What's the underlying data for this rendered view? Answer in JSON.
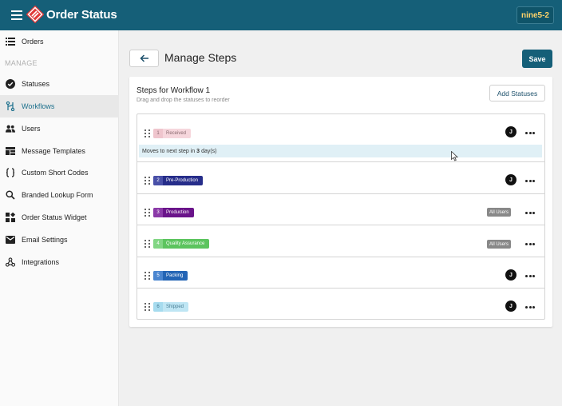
{
  "app": {
    "title": "Order Status",
    "account": "nine5-2"
  },
  "colors": {
    "brand": "#155f78",
    "active_link": "#1b6f8c"
  },
  "sidebar": {
    "top_item": {
      "label": "Orders",
      "icon": "list-icon"
    },
    "section": "MANAGE",
    "items": [
      {
        "label": "Statuses",
        "icon": "check-circle-icon",
        "active": false
      },
      {
        "label": "Workflows",
        "icon": "workflow-icon",
        "active": true
      },
      {
        "label": "Users",
        "icon": "users-icon",
        "active": false
      },
      {
        "label": "Message Templates",
        "icon": "template-icon",
        "active": false
      },
      {
        "label": "Custom Short Codes",
        "icon": "braces-icon",
        "active": false
      },
      {
        "label": "Branded Lookup Form",
        "icon": "search-icon",
        "active": false
      },
      {
        "label": "Order Status Widget",
        "icon": "widget-icon",
        "active": false
      },
      {
        "label": "Email Settings",
        "icon": "mail-icon",
        "active": false
      },
      {
        "label": "Integrations",
        "icon": "integrations-icon",
        "active": false
      }
    ]
  },
  "main": {
    "title": "Manage Steps",
    "save_label": "Save",
    "card": {
      "title": "Steps for Workflow 1",
      "subtitle": "Drag and drop the statuses to reorder",
      "add_label": "Add Statuses"
    },
    "steps": [
      {
        "num": "1",
        "name": "Received",
        "assignee": "J",
        "chip_bg": "#f6d6dc",
        "num_bg": "#efc5cd",
        "text_color": "#8a6a70",
        "transition": {
          "prefix": "Moves to next step in",
          "value": "3",
          "suffix": "day(s)"
        }
      },
      {
        "num": "2",
        "name": "Pre-Production",
        "assignee": "J",
        "chip_bg": "#262d8a",
        "num_bg": "#4950a8",
        "text_color": "#ffffff"
      },
      {
        "num": "3",
        "name": "Production",
        "badge": "All Users",
        "chip_bg": "#6a148a",
        "num_bg": "#8b3aa8",
        "text_color": "#ffffff"
      },
      {
        "num": "4",
        "name": "Quality Assurance",
        "badge": "All Users",
        "chip_bg": "#5cc45e",
        "num_bg": "#82d684",
        "text_color": "#ffffff"
      },
      {
        "num": "5",
        "name": "Packing",
        "assignee": "J",
        "chip_bg": "#2465b5",
        "num_bg": "#4b86d0",
        "text_color": "#ffffff"
      },
      {
        "num": "6",
        "name": "Shipped",
        "assignee": "J",
        "chip_bg": "#bfe6f4",
        "num_bg": "#a6dbee",
        "text_color": "#4a7f96"
      }
    ]
  }
}
